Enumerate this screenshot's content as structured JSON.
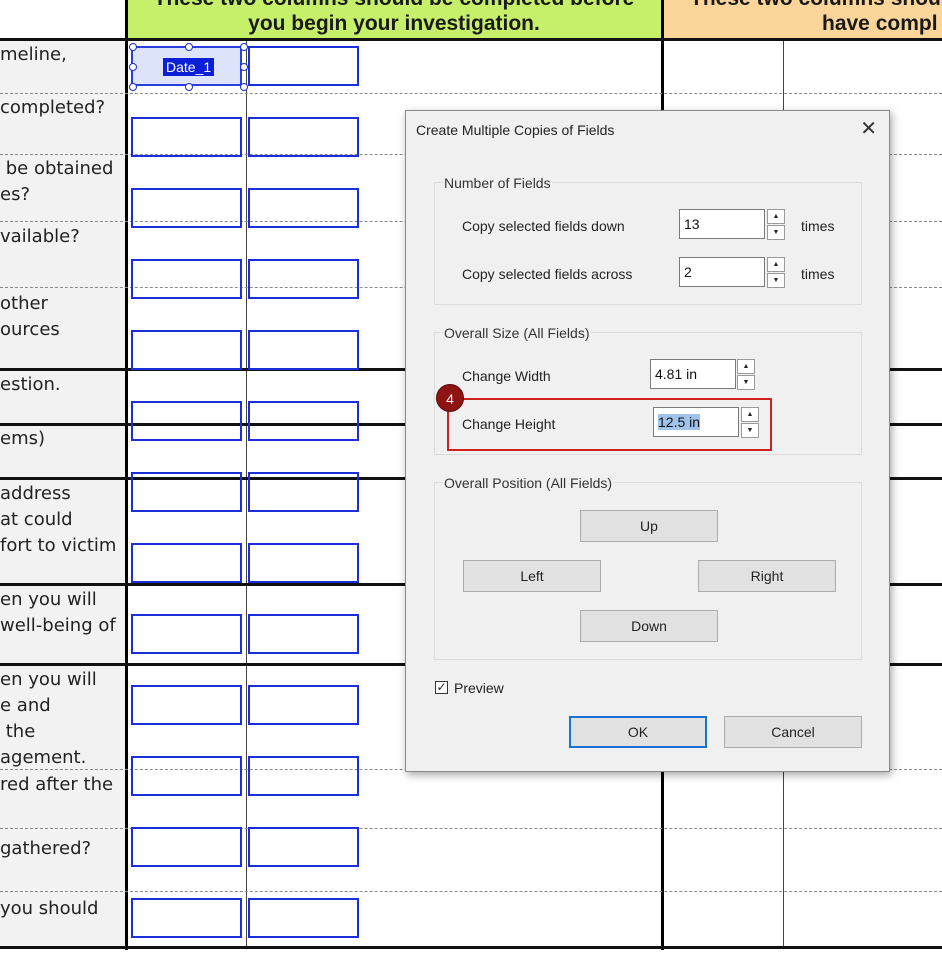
{
  "document": {
    "header_green": {
      "line1": "These two columns should be completed before",
      "line2": "you begin your investigation."
    },
    "header_orange": {
      "line1": "These two columns shou",
      "line2": "have compl"
    },
    "questions": [
      "meline,",
      "completed?",
      " be obtained\nes?",
      "vailable?",
      "other\nources",
      "estion.",
      "ems)",
      "address\nat could\nfort to victim",
      "en you will\nwell-being of",
      "en you will\ne and\n the\nagement.",
      "red after the",
      "gathered?",
      "you should"
    ],
    "selected_field_label": "Date_1"
  },
  "dialog": {
    "title": "Create Multiple Copies of Fields",
    "close_icon": "close-icon",
    "number_of_fields": {
      "title": "Number of Fields",
      "down_label": "Copy selected fields down",
      "down_value": "13",
      "across_label": "Copy selected fields across",
      "across_value": "2",
      "times_label": "times"
    },
    "overall_size": {
      "title": "Overall Size (All Fields)",
      "width_label": "Change Width",
      "width_value": "4.81 in",
      "height_label": "Change Height",
      "height_value": "12.5 in"
    },
    "overall_position": {
      "title": "Overall Position (All Fields)",
      "up": "Up",
      "left": "Left",
      "right": "Right",
      "down": "Down"
    },
    "preview_label": "Preview",
    "preview_checked": true,
    "ok_label": "OK",
    "cancel_label": "Cancel"
  },
  "callout": {
    "number": "4",
    "color": "#d02121"
  },
  "colors": {
    "field_border": "#1b2fd9",
    "header_green": "#c6ef6a",
    "header_orange": "#fbd59a"
  }
}
